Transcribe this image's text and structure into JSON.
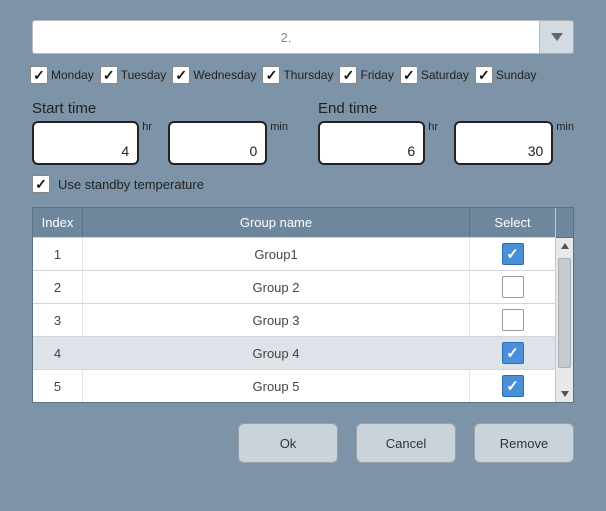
{
  "topSelect": {
    "value": "2."
  },
  "days": [
    {
      "label": "Monday",
      "checked": true
    },
    {
      "label": "Tuesday",
      "checked": true
    },
    {
      "label": "Wednesday",
      "checked": true
    },
    {
      "label": "Thursday",
      "checked": true
    },
    {
      "label": "Friday",
      "checked": true
    },
    {
      "label": "Saturday",
      "checked": true
    },
    {
      "label": "Sunday",
      "checked": true
    }
  ],
  "startTime": {
    "label": "Start time",
    "hr": "4",
    "min": "0"
  },
  "endTime": {
    "label": "End time",
    "hr": "6",
    "min": "30"
  },
  "units": {
    "hr": "hr",
    "min": "min"
  },
  "standby": {
    "label": "Use standby temperature",
    "checked": true
  },
  "table": {
    "headers": {
      "index": "Index",
      "name": "Group name",
      "select": "Select"
    },
    "rows": [
      {
        "index": "1",
        "name": "Group1",
        "selected": true,
        "highlighted": false
      },
      {
        "index": "2",
        "name": "Group 2",
        "selected": false,
        "highlighted": false
      },
      {
        "index": "3",
        "name": "Group 3",
        "selected": false,
        "highlighted": false
      },
      {
        "index": "4",
        "name": "Group 4",
        "selected": true,
        "highlighted": true
      },
      {
        "index": "5",
        "name": "Group 5",
        "selected": true,
        "highlighted": false
      }
    ]
  },
  "buttons": {
    "ok": "Ok",
    "cancel": "Cancel",
    "remove": "Remove"
  }
}
